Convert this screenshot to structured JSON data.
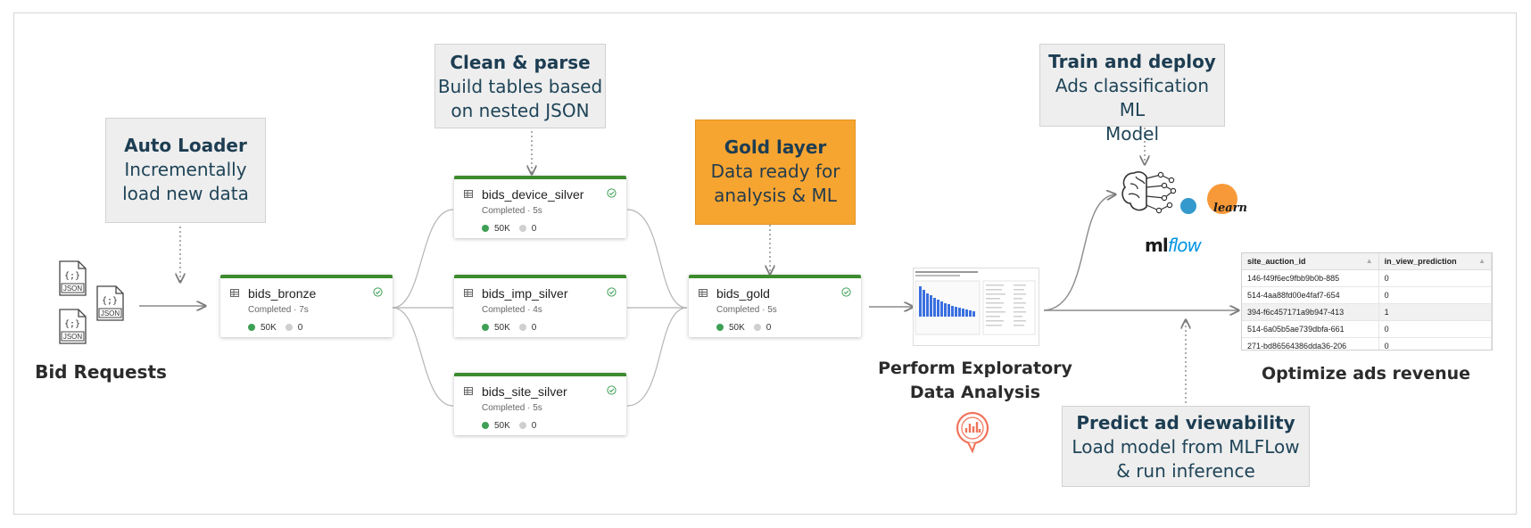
{
  "input": {
    "label": "Bid Requests",
    "file_label": "JSON",
    "file_glyph": "{;}"
  },
  "callouts": {
    "autoloader": {
      "title": "Auto Loader",
      "line1": "Incrementally",
      "line2": "load new data"
    },
    "clean": {
      "title": "Clean & parse",
      "line1": "Build tables based",
      "line2": "on nested JSON"
    },
    "gold": {
      "title": "Gold layer",
      "line1": "Data ready for",
      "line2": "analysis & ML"
    },
    "train": {
      "title": "Train and deploy",
      "line1": "Ads classification ML",
      "line2": "Model"
    },
    "predict": {
      "title": "Predict ad viewability",
      "line1": "Load model from MLFLow",
      "line2": "& run inference"
    }
  },
  "nodes": {
    "bronze": {
      "name": "bids_bronze",
      "status": "Completed · 7s",
      "rows": "50K",
      "dropped": "0"
    },
    "device": {
      "name": "bids_device_silver",
      "status": "Completed · 5s",
      "rows": "50K",
      "dropped": "0"
    },
    "imp": {
      "name": "bids_imp_silver",
      "status": "Completed · 4s",
      "rows": "50K",
      "dropped": "0"
    },
    "site": {
      "name": "bids_site_silver",
      "status": "Completed · 5s",
      "rows": "50K",
      "dropped": "0"
    },
    "gold": {
      "name": "bids_gold",
      "status": "Completed · 5s",
      "rows": "50K",
      "dropped": "0"
    }
  },
  "eda": {
    "line1": "Perform Exploratory",
    "line2": "Data Analysis"
  },
  "ml_logos": {
    "sklearn": "learn",
    "mlflow_ml": "ml",
    "mlflow_flow": "flow"
  },
  "output": {
    "label": "Optimize ads revenue"
  },
  "prediction_table": {
    "headers": [
      "site_auction_id",
      "in_view_prediction"
    ],
    "rows": [
      [
        "146-f49f6ec9fbb9b0b-885",
        "0"
      ],
      [
        "514-4aa88fd00e4faf7-654",
        "0"
      ],
      [
        "394-f6c457171a9b947-413",
        "1"
      ],
      [
        "514-6a05b5ae739dbfa-661",
        "0"
      ],
      [
        "271-bd86564386dda36-206",
        "0"
      ]
    ]
  },
  "colors": {
    "callout_bg": "#eeeeee",
    "gold_bg": "#f7a531",
    "node_border": "#3d8b2f",
    "title_text": "#1d3d52",
    "mlflow_blue": "#0194e2"
  }
}
